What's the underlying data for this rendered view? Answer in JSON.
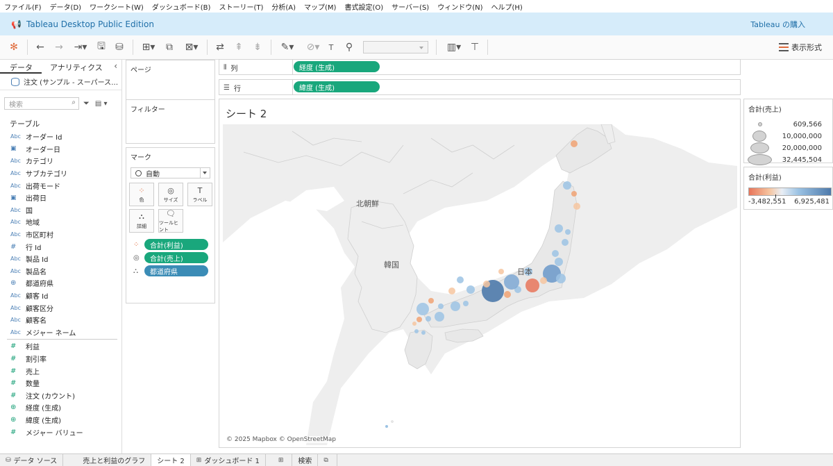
{
  "menu": [
    "ファイル(F)",
    "データ(D)",
    "ワークシート(W)",
    "ダッシュボード(B)",
    "ストーリー(T)",
    "分析(A)",
    "マップ(M)",
    "書式設定(O)",
    "サーバー(S)",
    "ウィンドウ(N)",
    "ヘルプ(H)"
  ],
  "banner": {
    "title": "Tableau Desktop Public Edition",
    "buy": "Tableau の購入"
  },
  "toolbar": {
    "show_me": "表示形式"
  },
  "datapane": {
    "tab_data": "データ",
    "tab_analytics": "アナリティクス",
    "source": "注文 (サンプル - スーパース…",
    "search_placeholder": "検索",
    "section_table": "テーブル",
    "dimensions": [
      {
        "type": "Abc",
        "name": "オーダー Id"
      },
      {
        "type": "date",
        "name": "オーダー日"
      },
      {
        "type": "Abc",
        "name": "カテゴリ"
      },
      {
        "type": "Abc",
        "name": "サブカテゴリ"
      },
      {
        "type": "Abc",
        "name": "出荷モード"
      },
      {
        "type": "date",
        "name": "出荷日"
      },
      {
        "type": "Abc",
        "name": "国"
      },
      {
        "type": "Abc",
        "name": "地域"
      },
      {
        "type": "Abc",
        "name": "市区町村"
      },
      {
        "type": "#",
        "name": "行 Id"
      },
      {
        "type": "Abc",
        "name": "製品 Id"
      },
      {
        "type": "Abc",
        "name": "製品名"
      },
      {
        "type": "geo",
        "name": "都道府県"
      },
      {
        "type": "Abc",
        "name": "顧客 Id"
      },
      {
        "type": "Abc",
        "name": "顧客区分"
      },
      {
        "type": "Abc",
        "name": "顧客名"
      },
      {
        "type": "Abc",
        "name": "メジャー ネーム"
      }
    ],
    "measures": [
      {
        "type": "#",
        "name": "利益"
      },
      {
        "type": "#",
        "name": "割引率"
      },
      {
        "type": "#",
        "name": "売上"
      },
      {
        "type": "#",
        "name": "数量"
      },
      {
        "type": "#",
        "name": "注文 (カウント)"
      },
      {
        "type": "geo",
        "name": "経度 (生成)"
      },
      {
        "type": "geo",
        "name": "緯度 (生成)"
      },
      {
        "type": "#",
        "name": "メジャー バリュー"
      }
    ]
  },
  "cards": {
    "pages": "ページ",
    "filters": "フィルター",
    "marks": "マーク",
    "mark_type": "自動",
    "mark_buttons": [
      "色",
      "サイズ",
      "ラベル",
      "詳細",
      "ツールヒント"
    ],
    "mark_pills": [
      {
        "icon": "color",
        "label": "合計(利益)",
        "color": "#19a77c"
      },
      {
        "icon": "size",
        "label": "合計(売上)",
        "color": "#19a77c"
      },
      {
        "icon": "detail",
        "label": "都道府県",
        "color": "#3b8cb6"
      }
    ]
  },
  "shelves": {
    "columns_label": "列",
    "columns_pill": "経度 (生成)",
    "rows_label": "行",
    "rows_pill": "緯度 (生成)"
  },
  "sheet": {
    "title": "シート 2",
    "labels": {
      "north_korea": "北朝鮮",
      "korea": "韓国",
      "japan": "日本"
    },
    "attribution": "© 2025 Mapbox © OpenStreetMap"
  },
  "legend_size": {
    "title": "合計(売上)",
    "values": [
      "609,566",
      "10,000,000",
      "20,000,000",
      "32,445,504"
    ]
  },
  "legend_color": {
    "title": "合計(利益)",
    "min": "-3,482,551",
    "max": "6,925,481"
  },
  "bottom_tabs": {
    "datasource": "データ ソース",
    "tabs": [
      "売上と利益のグラフ",
      "シート 2",
      "ダッシュボード 1"
    ],
    "extra": "検索"
  },
  "colors": {
    "positive": "#4e7aab",
    "negative": "#e8755a",
    "pill_green": "#19a77c",
    "pill_blue": "#3b8cb6"
  }
}
